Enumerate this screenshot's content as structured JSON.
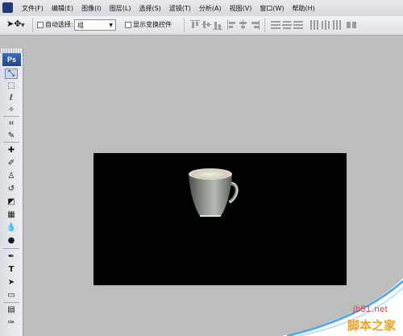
{
  "menubar": {
    "items": [
      {
        "label": "文件(F)"
      },
      {
        "label": "编辑(E)"
      },
      {
        "label": "图像(I)"
      },
      {
        "label": "图层(L)"
      },
      {
        "label": "选择(S)"
      },
      {
        "label": "滤镜(T)"
      },
      {
        "label": "分析(A)"
      },
      {
        "label": "视图(V)"
      },
      {
        "label": "窗口(W)"
      },
      {
        "label": "帮助(H)"
      }
    ]
  },
  "options": {
    "tool_icon": "move-tool-icon",
    "auto_select_label": "自动选择:",
    "auto_select_checked": false,
    "auto_select_value": "组",
    "show_transform_label": "显示变换控件",
    "show_transform_checked": false
  },
  "toolbox": {
    "badge": "Ps",
    "tools": [
      {
        "name": "move-tool-icon",
        "glyph": "⤡"
      },
      {
        "name": "marquee-tool-icon",
        "glyph": "⬚"
      },
      {
        "name": "lasso-tool-icon",
        "glyph": "ℓ"
      },
      {
        "name": "magic-wand-tool-icon",
        "glyph": "✧"
      },
      {
        "name": "crop-tool-icon",
        "glyph": "⌗"
      },
      {
        "name": "slice-tool-icon",
        "glyph": "✎"
      },
      {
        "name": "healing-brush-tool-icon",
        "glyph": "✚"
      },
      {
        "name": "brush-tool-icon",
        "glyph": "✐"
      },
      {
        "name": "clone-stamp-tool-icon",
        "glyph": "♙"
      },
      {
        "name": "history-brush-tool-icon",
        "glyph": "↺"
      },
      {
        "name": "eraser-tool-icon",
        "glyph": "◩"
      },
      {
        "name": "gradient-tool-icon",
        "glyph": "▦"
      },
      {
        "name": "blur-tool-icon",
        "glyph": "💧"
      },
      {
        "name": "dodge-tool-icon",
        "glyph": "●"
      },
      {
        "name": "pen-tool-icon",
        "glyph": "✒"
      },
      {
        "name": "type-tool-icon",
        "glyph": "T"
      },
      {
        "name": "path-selection-tool-icon",
        "glyph": "➤"
      },
      {
        "name": "shape-tool-icon",
        "glyph": "▭"
      },
      {
        "name": "notes-tool-icon",
        "glyph": "▤"
      },
      {
        "name": "eyedropper-tool-icon",
        "glyph": "✑"
      }
    ]
  },
  "watermark": {
    "domain": "jb51.net",
    "text": "脚本之家"
  }
}
